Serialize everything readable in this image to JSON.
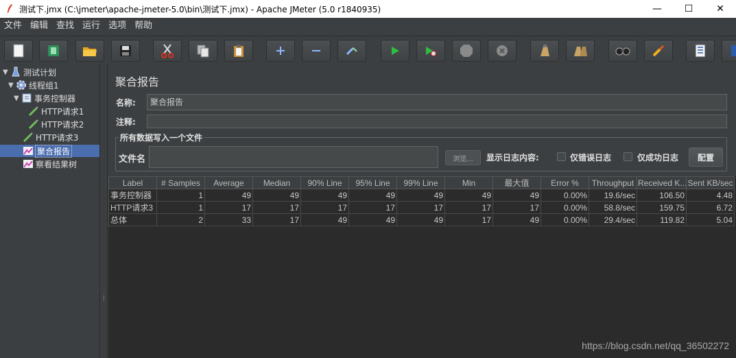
{
  "window": {
    "title": "测试下.jmx (C:\\jmeter\\apache-jmeter-5.0\\bin\\测试下.jmx) - Apache JMeter (5.0 r1840935)",
    "minimize": "—",
    "maximize": "☐",
    "close": "✕"
  },
  "menu": [
    "文件",
    "编辑",
    "查找",
    "运行",
    "选项",
    "帮助"
  ],
  "toolbar_icons": [
    "new-icon",
    "templates-icon",
    "open-icon",
    "save-icon",
    "cut-icon",
    "copy-icon",
    "paste-icon",
    "expand-icon",
    "collapse-icon",
    "toggle-icon",
    "start-icon",
    "start-no-pause-icon",
    "stop-icon",
    "shutdown-icon",
    "clear-icon",
    "clear-all-icon",
    "search-icon",
    "reset-search-icon",
    "function-helper-icon",
    "help-icon"
  ],
  "tree": {
    "items": [
      {
        "label": "测试计划",
        "icon": "test-plan-icon"
      },
      {
        "label": "线程组1",
        "icon": "thread-group-icon"
      },
      {
        "label": "事务控制器",
        "icon": "transaction-controller-icon"
      },
      {
        "label": "HTTP请求1",
        "icon": "sampler-icon"
      },
      {
        "label": "HTTP请求2",
        "icon": "sampler-icon"
      },
      {
        "label": "HTTP请求3",
        "icon": "sampler-icon"
      },
      {
        "label": "聚合报告",
        "icon": "listener-icon"
      },
      {
        "label": "察看结果树",
        "icon": "listener-icon"
      }
    ]
  },
  "panel": {
    "title": "聚合报告",
    "name_label": "名称:",
    "name_value": "聚合报告",
    "comment_label": "注释:",
    "comment_value": "",
    "file_group_title": "所有数据写入一个文件",
    "file_label": "文件名",
    "browse_label": "浏览...",
    "log_label": "显示日志内容:",
    "errors_only_label": "仅错误日志",
    "success_only_label": "仅成功日志",
    "config_label": "配置"
  },
  "table": {
    "headers": [
      "Label",
      "# Samples",
      "Average",
      "Median",
      "90% Line",
      "95% Line",
      "99% Line",
      "Min",
      "最大值",
      "Error %",
      "Throughput",
      "Received K...",
      "Sent KB/sec"
    ],
    "rows": [
      [
        "事务控制器",
        "1",
        "49",
        "49",
        "49",
        "49",
        "49",
        "49",
        "49",
        "0.00%",
        "19.6/sec",
        "106.50",
        "4.48"
      ],
      [
        "HTTP请求3",
        "1",
        "17",
        "17",
        "17",
        "17",
        "17",
        "17",
        "17",
        "0.00%",
        "58.8/sec",
        "159.75",
        "6.72"
      ],
      [
        "总体",
        "2",
        "33",
        "17",
        "49",
        "49",
        "49",
        "17",
        "49",
        "0.00%",
        "29.4/sec",
        "119.82",
        "5.04"
      ]
    ]
  },
  "watermark": "https://blog.csdn.net/qq_36502272"
}
